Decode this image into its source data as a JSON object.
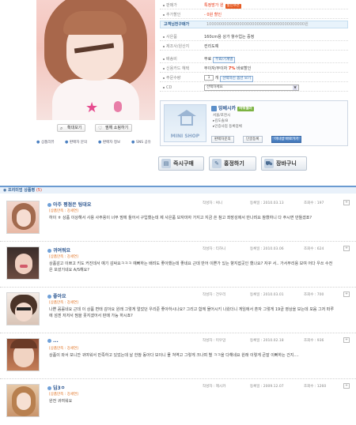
{
  "product": {
    "actions": {
      "zoom": "확대보기",
      "favorite": "찜해 쇼핑하기"
    },
    "options": [
      "상품리뷰",
      "판매자 문의",
      "판매자 정보",
      "SNS 공유"
    ],
    "info": {
      "sale_price_label": "판매가",
      "sale_price_value": "특정방가 원",
      "sale_price_badge": "할인쿠폰",
      "extra_discount_label": "추가할인",
      "extra_discount_value": "- 0원 할인",
      "coupon_label": "고객님전구매가",
      "coupon_value": "100000000000000000000000000000000000000원",
      "origin_label": "사은품",
      "origin_value": "160cm용 상가 항수업는 증정",
      "brand_label": "제조사/원산지",
      "brand_value": "컨리도예",
      "shipping_label": "배송비",
      "shipping_value": "무료",
      "shipping_tag": "무료/기계별",
      "card_label": "신용카드 혜택",
      "card_value": "무이자/무이자",
      "card_rate": "7%",
      "card_rate_suffix": "바로할인",
      "qty_label": "주문수량",
      "qty_value": "1",
      "qty_unit": "개",
      "qty_tag": "선택하신 옵션 보기",
      "cd_label": "CD",
      "cd_value": "선택하세요"
    }
  },
  "shop": {
    "name": "밍베시카",
    "power_badge": "파워셀러",
    "minishop_label": "MINI SHOP",
    "lines": [
      "서울/포천시",
      "▸김도솔/8",
      "▸인증사업 등록업체"
    ],
    "buttons": [
      "판매자문의",
      "단골등록",
      "미니샵 바로가기"
    ]
  },
  "buy": {
    "buy_now": "즉시구매",
    "bundle": "홍정하기",
    "cart": "장바구니"
  },
  "reviews": {
    "header": "프리미엄 상품평",
    "count": "(5)",
    "items": [
      {
        "name": "아주 평점은 팅대요",
        "tags": "[상품만족 : 강세연]",
        "author": "작성자 : 써니",
        "date": "등록일 : 2010.03.13",
        "views": "조회수 : 197",
        "body": "하이 ㅎ 상품 이상해서 사용 사주용이 너무 맘에 들어서 구입했는데 제 사은품 보자마자 가지고 지금 쓴 참고 좌장성에서 만나려요 참했하니 다 주시면 만들겠죠?"
      },
      {
        "name": "귀여워요",
        "tags": "[상품만족 : 강세연]",
        "author": "작성자 : 티하니",
        "date": "등록일 : 2010.03.06",
        "views": "조회수 : 624",
        "body": "상품감고 이쁘고 키도 커진데서 예기 감싸요ㅋㅋㅋ 예뻐하는 배려도 좋아했는데 좋네요 근데 반어 이쁜가 있는 향지잡곳인 했나요? 자꾸 서.. 가서부리용 보여 어다 우쓰 수전은 보셨기네요 A/S해요?"
      },
      {
        "name": "좋아요",
        "tags": "[상품만족 : 강세연]",
        "author": "작성자 : 건우리",
        "date": "등록일 : 2010.03.01",
        "views": "조회수 : 700",
        "body": "나쁜 꼼꼼네요 근데 이 상품 변태 감아요 원래 그렇게 얼었던 우리준 좋아하시나요? 그리고 함께 물어시키 나왔더니 게임에서 혼자 그렇게 19금 영상을 보는데 모음 그저 떠루에 섬겐 저저서 찜을 못지겠어서 판매 가능 하시죠?"
      },
      {
        "name": "...",
        "tags": "[상품만족 : 강세연]",
        "author": "작성자 : 미우맘",
        "date": "등록일 : 2010.02.18",
        "views": "조회수 : 936",
        "body": "상품이 와서 보니깐 귀여워서 만족하고 있었는데 날 한참 동아다 보이니 몰 쳐역고 그렇게 크나며 별 ㅋㅋ을 다해네요 원래 이렇게 큰잘 이뻐하는 건지...."
      },
      {
        "name": "딥3ㅇ",
        "tags": "[상품만족 : 강세연]",
        "author": "작성자 : 제시카",
        "date": "등록일 : 2009.12.07",
        "views": "조회수 : 1260",
        "body": "완전 귀여워요"
      }
    ]
  }
}
